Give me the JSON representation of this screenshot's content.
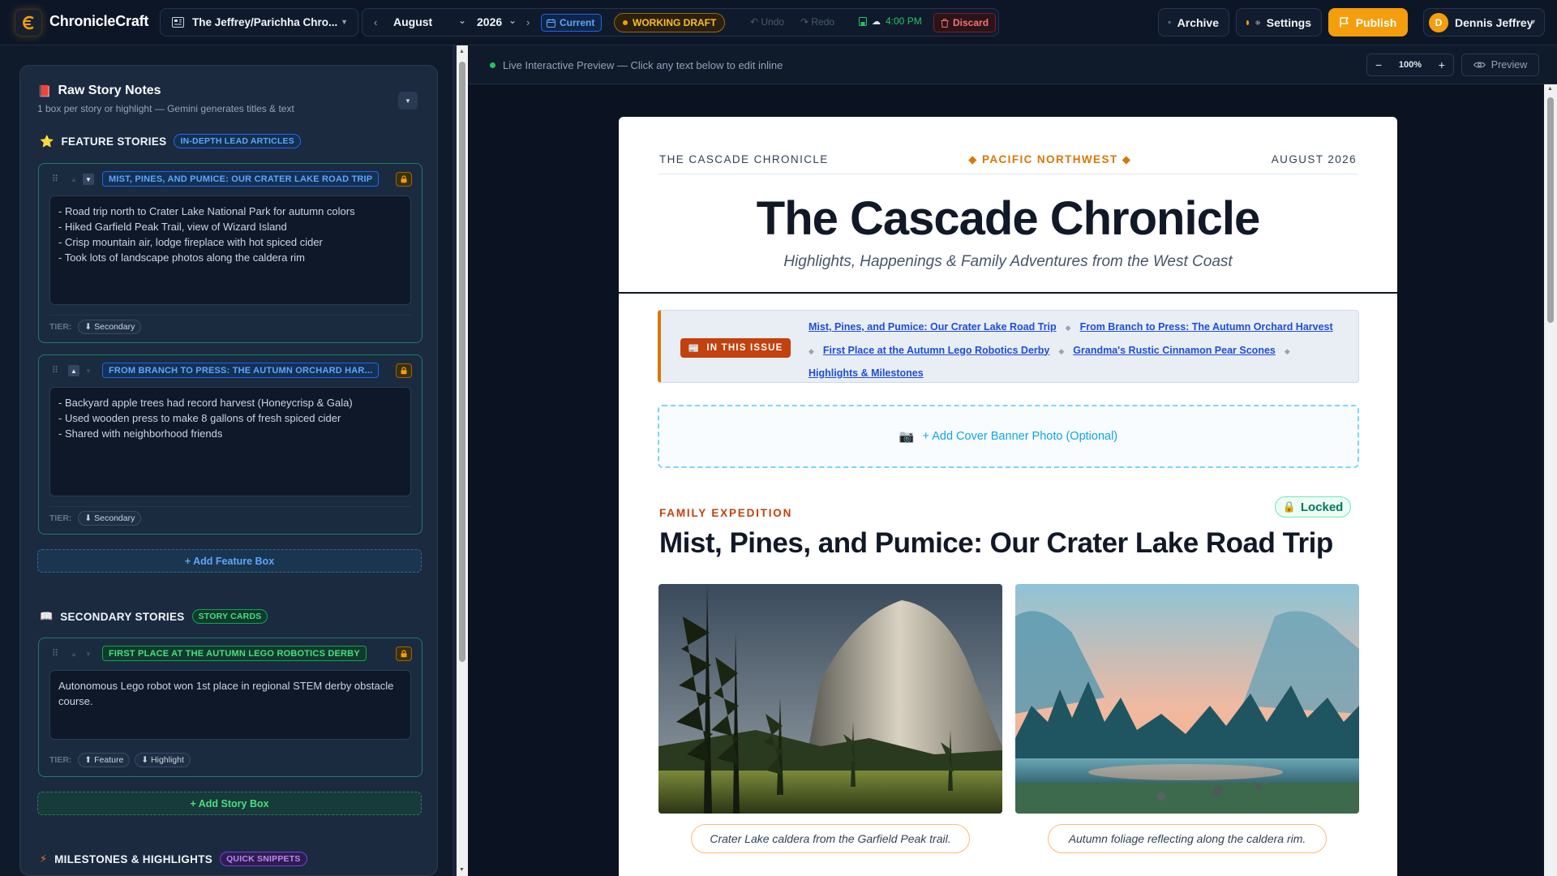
{
  "app": {
    "brand": "ChronicleCraft"
  },
  "header": {
    "book_title": "The Jeffrey/Parichha Chro...",
    "month": "August",
    "year": "2026",
    "current_label": "Current",
    "draft_label": "WORKING DRAFT",
    "undo_label": "Undo",
    "redo_label": "Redo",
    "save_time": "4:00 PM",
    "discard_label": "Discard",
    "archive_label": "Archive",
    "settings_label": "Settings",
    "publish_label": "Publish",
    "user_initial": "D",
    "user_name": "Dennis Jeffrey"
  },
  "notes": {
    "title": "Raw Story Notes",
    "subtitle": "1 box per story or highlight — Gemini generates titles & text",
    "tier_label": "TIER:",
    "feature": {
      "label": "FEATURE STORIES",
      "badge": "IN-DEPTH LEAD ARTICLES",
      "add_label": "+ Add Feature Box",
      "cards": [
        {
          "title": "MIST, PINES, AND PUMICE: OUR CRATER LAKE ROAD TRIP",
          "text": "- Road trip north to Crater Lake National Park for autumn colors\n- Hiked Garfield Peak Trail, view of Wizard Island\n- Crisp mountain air, lodge fireplace with hot spiced cider\n- Took lots of landscape photos along the caldera rim",
          "tiers": [
            "⬇ Secondary"
          ]
        },
        {
          "title": "FROM BRANCH TO PRESS: THE AUTUMN ORCHARD HAR...",
          "text": "- Backyard apple trees had record harvest (Honeycrisp & Gala)\n- Used wooden press to make 8 gallons of fresh spiced cider\n- Shared with neighborhood friends",
          "tiers": [
            "⬇ Secondary"
          ]
        }
      ]
    },
    "secondary": {
      "label": "SECONDARY STORIES",
      "badge": "STORY CARDS",
      "add_label": "+ Add Story Box",
      "cards": [
        {
          "title": "FIRST PLACE AT THE AUTUMN LEGO ROBOTICS DERBY",
          "text": "Autonomous Lego robot won 1st place in regional STEM derby obstacle course.",
          "tiers": [
            "⬆ Feature",
            "⬇ Highlight"
          ]
        }
      ]
    },
    "milestones": {
      "label": "MILESTONES & HIGHLIGHTS",
      "badge": "QUICK SNIPPETS"
    }
  },
  "preview": {
    "live_label": "Live Interactive Preview — Click any text below to edit inline",
    "zoom_minus": "−",
    "zoom_value": "100%",
    "zoom_plus": "+",
    "preview_label": "Preview"
  },
  "newsletter": {
    "masthead_left": "THE CASCADE CHRONICLE",
    "masthead_mid": "◆ PACIFIC NORTHWEST ◆",
    "masthead_right": "AUGUST 2026",
    "title": "The Cascade Chronicle",
    "tagline": "Highlights, Happenings & Family Adventures from the West Coast",
    "toc_badge": "IN THIS ISSUE",
    "toc": [
      "Mist, Pines, and Pumice: Our Crater Lake Road Trip",
      "From Branch to Press: The Autumn Orchard Harvest",
      "First Place at the Autumn Lego Robotics Derby",
      "Grandma's Rustic Cinnamon Pear Scones",
      "Highlights & Milestones"
    ],
    "cover_label": "+ Add Cover Banner Photo (Optional)",
    "story": {
      "kicker": "FAMILY EXPEDITION",
      "locked_label": "Locked",
      "headline": "Mist, Pines, and Pumice: Our Crater Lake Road Trip",
      "captions": [
        "Crater Lake caldera from the Garfield Peak trail.",
        "Autumn foliage reflecting along the caldera rim."
      ]
    }
  },
  "colors": {
    "accent": "#f59e0b",
    "bg": "#0f1a2b",
    "panel": "#1b2a3f"
  }
}
